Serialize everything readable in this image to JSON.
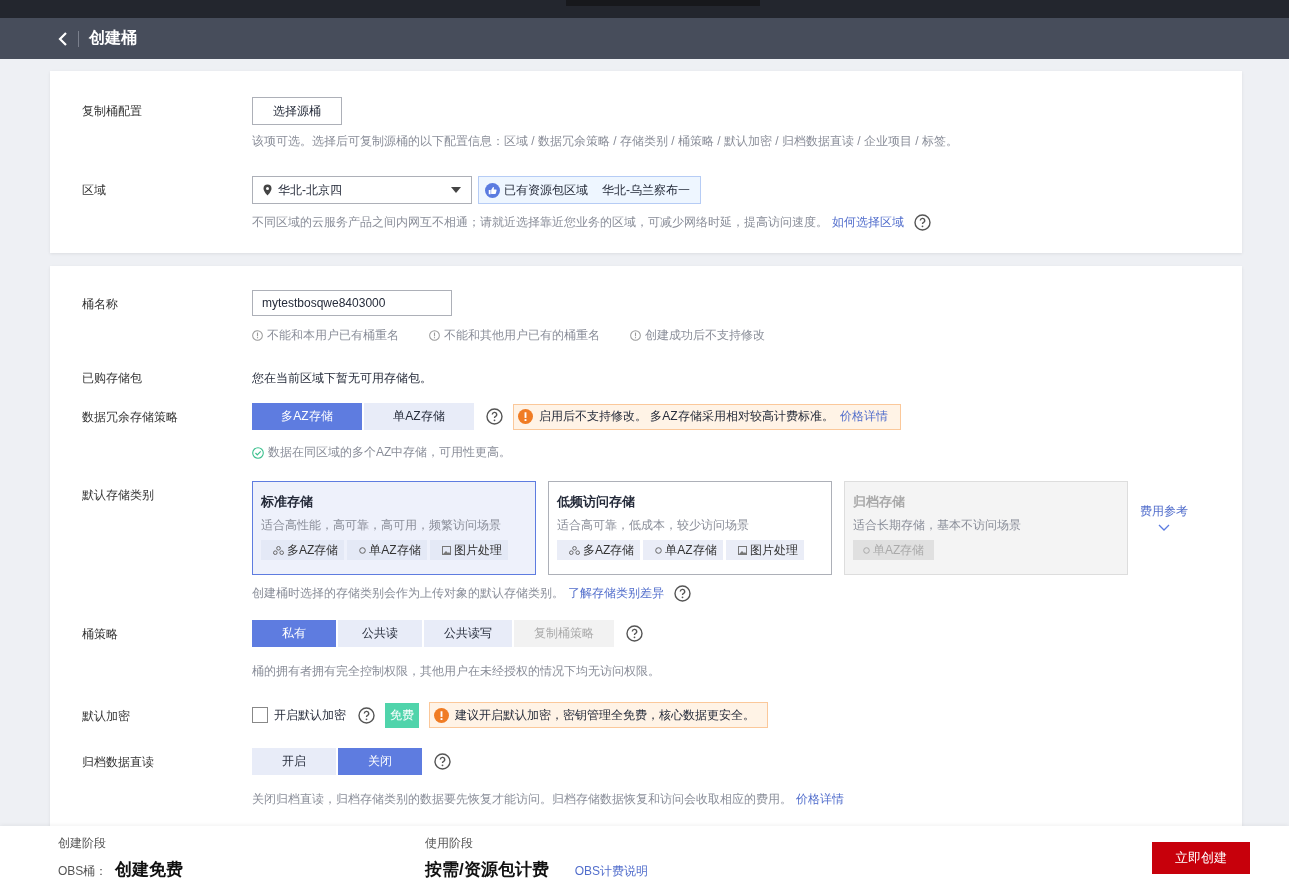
{
  "header": {
    "title": "创建桶"
  },
  "copy_config": {
    "label": "复制桶配置",
    "button": "选择源桶",
    "hint": "该项可选。选择后可复制源桶的以下配置信息：区域 / 数据冗余策略 / 存储类别 / 桶策略 / 默认加密 / 归档数据直读 / 企业项目 / 标签。"
  },
  "region": {
    "label": "区域",
    "value": "华北-北京四",
    "badge_label": "已有资源包区域",
    "badge_value": "华北-乌兰察布一",
    "hint": "不同区域的云服务产品之间内网互不相通；请就近选择靠近您业务的区域，可减少网络时延，提高访问速度。",
    "link": "如何选择区域"
  },
  "bucket_name": {
    "label": "桶名称",
    "value": "mytestbosqwe8403000",
    "rules": [
      "不能和本用户已有桶重名",
      "不能和其他用户已有的桶重名",
      "创建成功后不支持修改"
    ]
  },
  "package": {
    "label": "已购存储包",
    "text": "您在当前区域下暂无可用存储包。"
  },
  "redundancy": {
    "label": "数据冗余存储策略",
    "options": [
      {
        "label": "多AZ存储",
        "selected": true
      },
      {
        "label": "单AZ存储",
        "selected": false
      }
    ],
    "warning": "启用后不支持修改。 多AZ存储采用相对较高计费标准。",
    "link": "价格详情",
    "note": "数据在同区域的多个AZ中存储，可用性更高。"
  },
  "storage_class": {
    "label": "默认存储类别",
    "cards": [
      {
        "title": "标准存储",
        "desc": "适合高性能，高可靠，高可用，频繁访问场景",
        "selected": true,
        "disabled": false,
        "tags": [
          {
            "kind": "multi",
            "label": "多AZ存储"
          },
          {
            "kind": "single",
            "label": "单AZ存储"
          },
          {
            "kind": "image",
            "label": "图片处理"
          }
        ]
      },
      {
        "title": "低频访问存储",
        "desc": "适合高可靠，低成本，较少访问场景",
        "selected": false,
        "disabled": false,
        "tags": [
          {
            "kind": "multi",
            "label": "多AZ存储"
          },
          {
            "kind": "single",
            "label": "单AZ存储"
          },
          {
            "kind": "image",
            "label": "图片处理"
          }
        ]
      },
      {
        "title": "归档存储",
        "desc": "适合长期存储，基本不访问场景",
        "selected": false,
        "disabled": true,
        "tags": [
          {
            "kind": "single",
            "label": "单AZ存储"
          }
        ]
      }
    ],
    "fee_link": "费用参考",
    "hint": "创建桶时选择的存储类别会作为上传对象的默认存储类别。",
    "link": "了解存储类别差异"
  },
  "policy": {
    "label": "桶策略",
    "options": [
      {
        "label": "私有",
        "selected": true,
        "disabled": false
      },
      {
        "label": "公共读",
        "selected": false,
        "disabled": false
      },
      {
        "label": "公共读写",
        "selected": false,
        "disabled": false
      },
      {
        "label": "复制桶策略",
        "selected": false,
        "disabled": true
      }
    ],
    "hint": "桶的拥有者拥有完全控制权限，其他用户在未经授权的情况下均无访问权限。"
  },
  "encryption": {
    "label": "默认加密",
    "checkbox": "开启默认加密",
    "checked": false,
    "badge": "免费",
    "warning": "建议开启默认加密，密钥管理全免费，核心数据更安全。"
  },
  "archive_read": {
    "label": "归档数据直读",
    "options": [
      {
        "label": "开启",
        "selected": false
      },
      {
        "label": "关闭",
        "selected": true
      }
    ],
    "hint": "关闭归档直读，归档存储类别的数据要先恢复才能访问。归档存储数据恢复和访问会收取相应的费用。",
    "link": "价格详情"
  },
  "footer": {
    "create_stage": "创建阶段",
    "obs_label": "OBS桶：",
    "create_price": "创建免费",
    "use_stage": "使用阶段",
    "use_price": "按需/资源包计费",
    "billing_link": "OBS计费说明",
    "submit": "立即创建"
  }
}
